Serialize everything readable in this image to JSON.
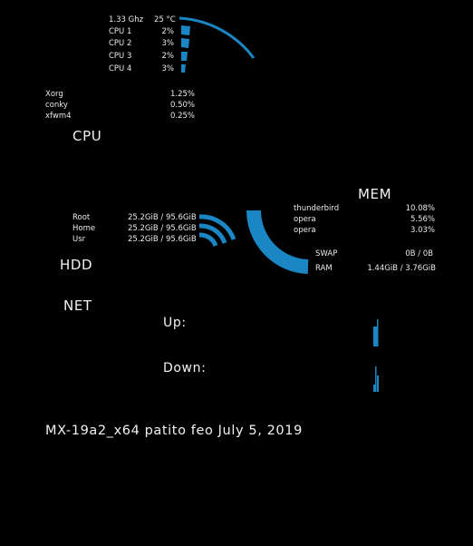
{
  "colors": {
    "accent": "#1a86c4",
    "background": "#000000",
    "text": "#eaeaea"
  },
  "cpu": {
    "label": "CPU",
    "freq": "1.33 Ghz",
    "temp": "25 °C",
    "cores": [
      {
        "name": "CPU 1",
        "usage": "2%"
      },
      {
        "name": "CPU 2",
        "usage": "3%"
      },
      {
        "name": "CPU 3",
        "usage": "2%"
      },
      {
        "name": "CPU 4",
        "usage": "3%"
      }
    ],
    "processes": [
      {
        "name": "Xorg",
        "usage": "1.25%"
      },
      {
        "name": "conky",
        "usage": "0.50%"
      },
      {
        "name": "xfwm4",
        "usage": "0.25%"
      }
    ]
  },
  "hdd": {
    "label": "HDD",
    "drives": [
      {
        "name": "Root",
        "usage": "25.2GiB / 95.6GiB",
        "fraction": 0.2636
      },
      {
        "name": "Home",
        "usage": "25.2GiB / 95.6GiB",
        "fraction": 0.2636
      },
      {
        "name": "Usr",
        "usage": "25.2GiB / 95.6GiB",
        "fraction": 0.2636
      }
    ]
  },
  "mem": {
    "label": "MEM",
    "processes": [
      {
        "name": "thunderbird",
        "usage": "10.08%"
      },
      {
        "name": "opera",
        "usage": "5.56%"
      },
      {
        "name": "opera",
        "usage": "3.03%"
      }
    ],
    "swap_label": "SWAP",
    "swap_value": "0B  / 0B",
    "ram_label": "RAM",
    "ram_value": "1.44GiB / 3.76GiB",
    "ram_fraction": 0.383
  },
  "net": {
    "label": "NET",
    "up_label": "Up:",
    "down_label": "Down:"
  },
  "footer": {
    "text": "MX-19a2_x64 patito feo July 5, 2019"
  }
}
